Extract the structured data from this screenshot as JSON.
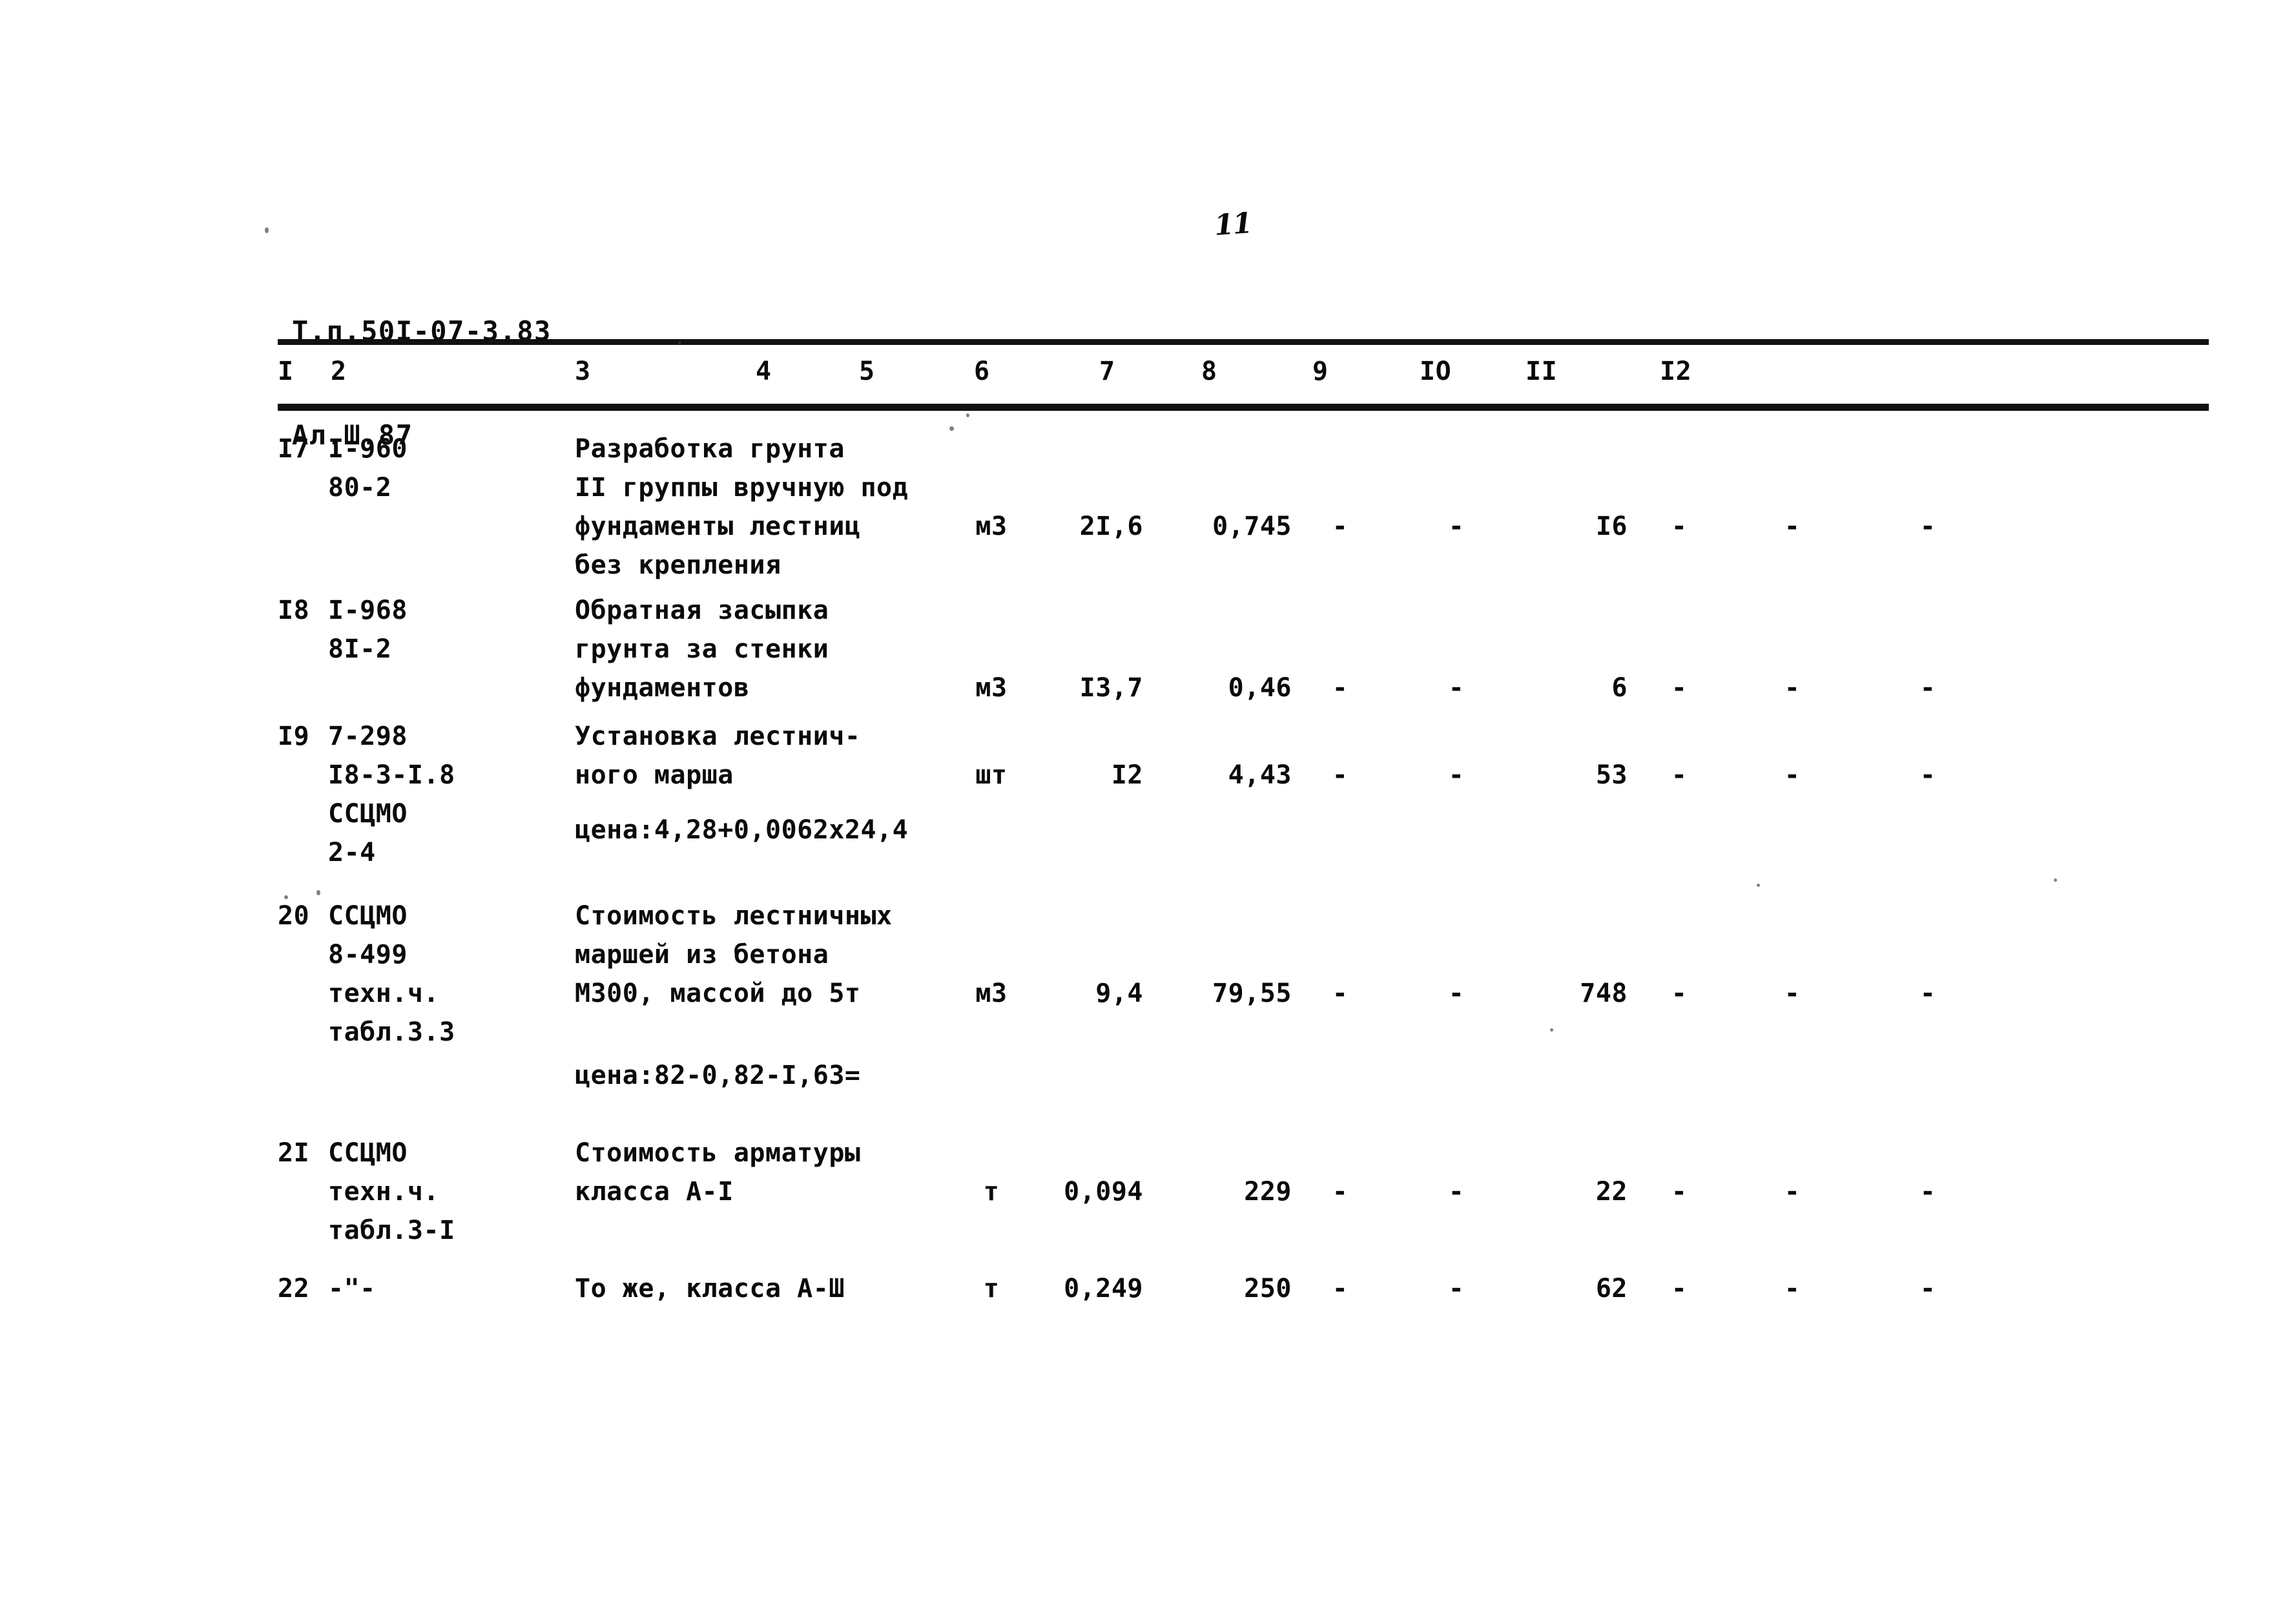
{
  "document": {
    "header_line1": "Т.п.50I-07-3.83",
    "header_line2": "Ал.Ш.87",
    "page_number": "11"
  },
  "table": {
    "column_headers": [
      "I",
      "2",
      "3",
      "4",
      "5",
      "6",
      "7",
      "8",
      "9",
      "IO",
      "II",
      "I2"
    ],
    "rows": [
      {
        "num": "I7",
        "code": "I-960\n80-2",
        "description": "Разработка грунта\nII группы вручную под\nфундаменты лестниц\nбез крепления",
        "unit": "м3",
        "c5": "2I,6",
        "c6": "0,745",
        "c7": "-",
        "c8": "-",
        "c9": "I6",
        "c10": "-",
        "c11": "-",
        "c12": "-",
        "note": ""
      },
      {
        "num": "I8",
        "code": "I-968\n8I-2",
        "description": "Обратная засыпка\nгрунта за стенки\nфундаментов",
        "unit": "м3",
        "c5": "I3,7",
        "c6": "0,46",
        "c7": "-",
        "c8": "-",
        "c9": "6",
        "c10": "-",
        "c11": "-",
        "c12": "-",
        "note": ""
      },
      {
        "num": "I9",
        "code": "7-298\nI8-3-I.8\nССЦМО\n2-4",
        "description": "Установка лестнич-\nного марша",
        "unit": "шт",
        "c5": "I2",
        "c6": "4,43",
        "c7": "-",
        "c8": "-",
        "c9": "53",
        "c10": "-",
        "c11": "-",
        "c12": "-",
        "note": "цена:4,28+0,0062х24,4"
      },
      {
        "num": "20",
        "code": "ССЦМО\n8-499\nтехн.ч.\nтабл.3.3",
        "description": "Стоимость лестничных\nмаршей из бетона\nМ300, массой до 5т",
        "unit": "м3",
        "c5": "9,4",
        "c6": "79,55",
        "c7": "-",
        "c8": "-",
        "c9": "748",
        "c10": "-",
        "c11": "-",
        "c12": "-",
        "note": "цена:82-0,82-I,63="
      },
      {
        "num": "2I",
        "code": "ССЦМО\nтехн.ч.\nтабл.3-I",
        "description": "Стоимость арматуры\nкласса А-I",
        "unit": "т",
        "c5": "0,094",
        "c6": "229",
        "c7": "-",
        "c8": "-",
        "c9": "22",
        "c10": "-",
        "c11": "-",
        "c12": "-",
        "note": ""
      },
      {
        "num": "22",
        "code": "-\"-",
        "description": "То же, класса А-Ш",
        "unit": "т",
        "c5": "0,249",
        "c6": "250",
        "c7": "-",
        "c8": "-",
        "c9": "62",
        "c10": "-",
        "c11": "-",
        "c12": "-",
        "note": ""
      }
    ]
  }
}
